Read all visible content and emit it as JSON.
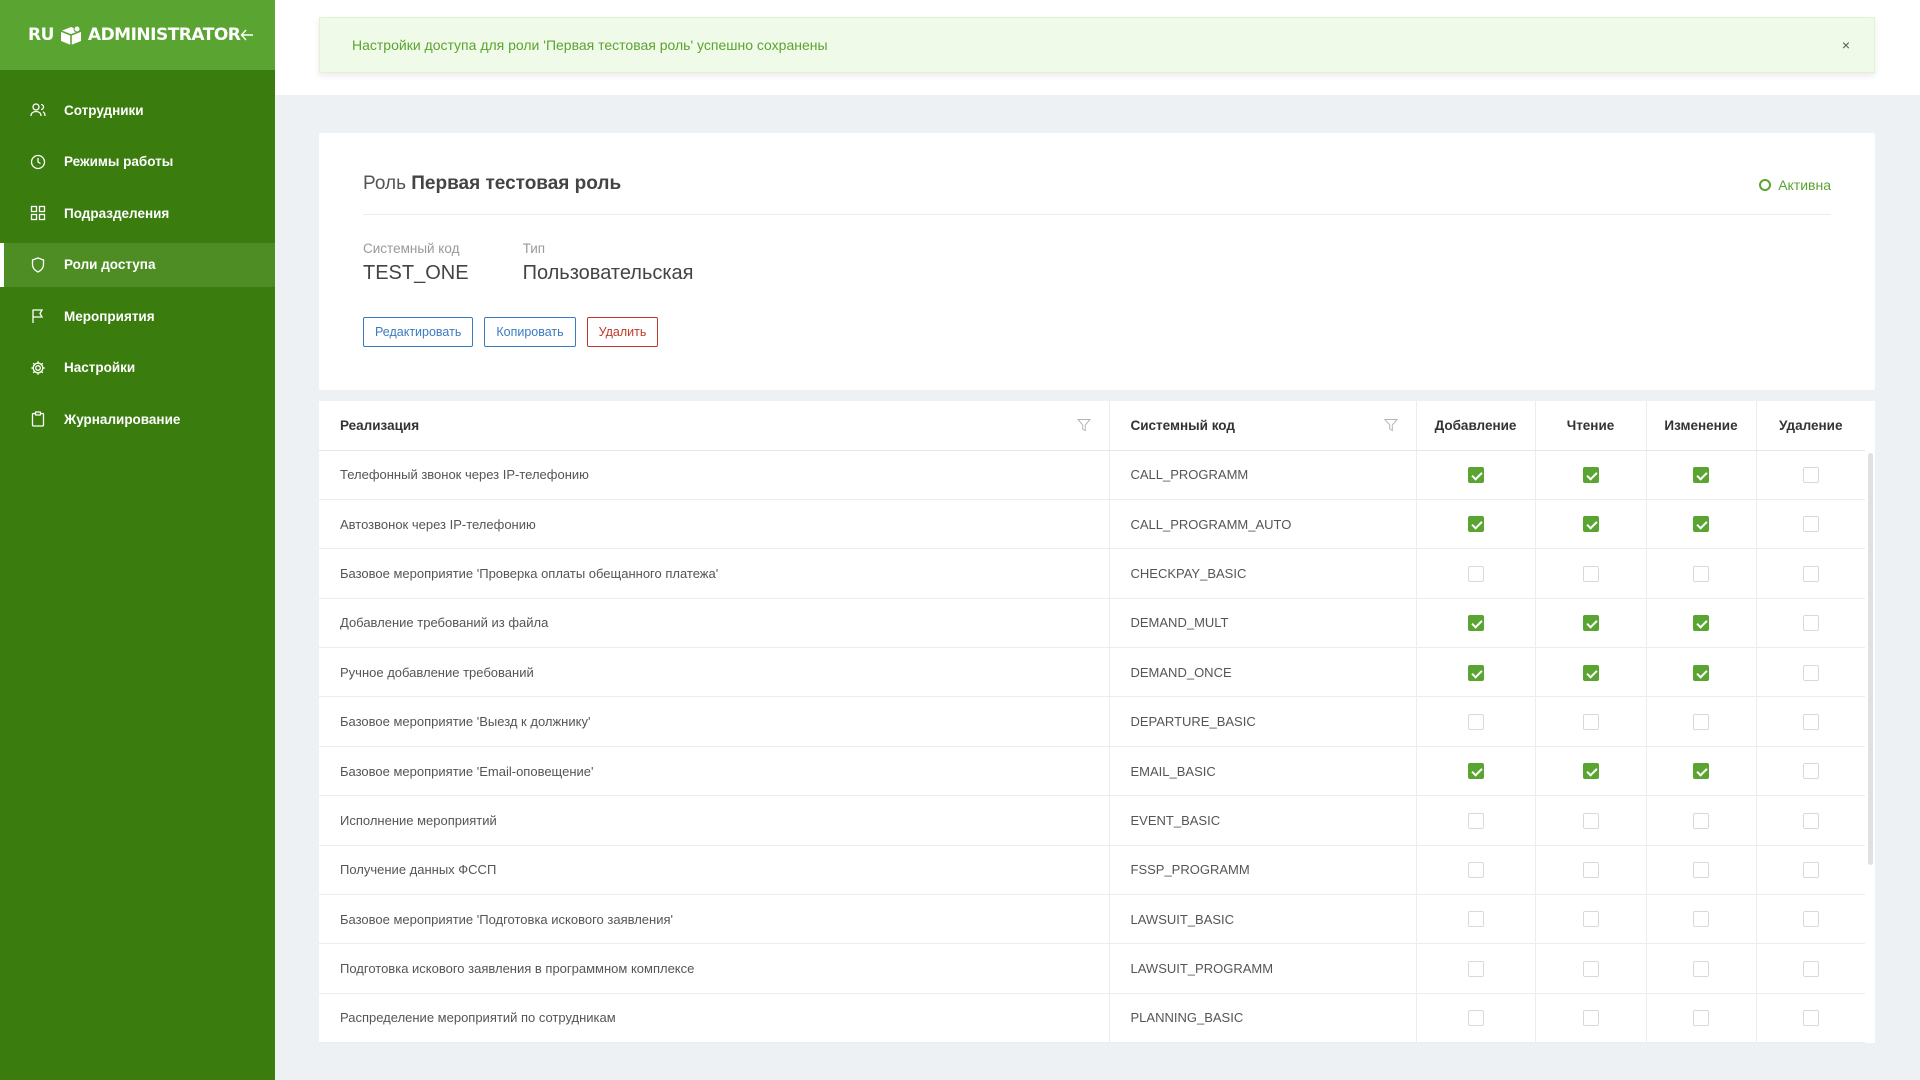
{
  "sidebar": {
    "logo_left": "RU",
    "logo_right": "ADMINISTRATOR",
    "items": [
      {
        "label": "Сотрудники",
        "icon": "users-icon"
      },
      {
        "label": "Режимы работы",
        "icon": "clock-icon"
      },
      {
        "label": "Подразделения",
        "icon": "grid-icon"
      },
      {
        "label": "Роли доступа",
        "icon": "shield-icon"
      },
      {
        "label": "Мероприятия",
        "icon": "flag-icon"
      },
      {
        "label": "Настройки",
        "icon": "gear-icon"
      },
      {
        "label": "Журналирование",
        "icon": "clipboard-icon"
      }
    ],
    "active_index": 3
  },
  "alert": {
    "message": "Настройки доступа для роли 'Первая тестовая роль' успешно сохранены",
    "close": "×"
  },
  "role": {
    "prefix": "Роль",
    "name": "Первая тестовая роль",
    "status": "Активна",
    "code_label": "Системный код",
    "code": "TEST_ONE",
    "type_label": "Тип",
    "type": "Пользовательская",
    "edit_label": "Редактировать",
    "copy_label": "Копировать",
    "delete_label": "Удалить"
  },
  "table": {
    "headers": [
      "Реализация",
      "Системный код",
      "Добавление",
      "Чтение",
      "Изменение",
      "Удаление"
    ],
    "rows": [
      {
        "name": "Телефонный звонок через IP-телефонию",
        "code": "CALL_PROGRAMM",
        "perms": [
          true,
          true,
          true,
          false
        ]
      },
      {
        "name": "Автозвонок через IP-телефонию",
        "code": "CALL_PROGRAMM_AUTO",
        "perms": [
          true,
          true,
          true,
          false
        ]
      },
      {
        "name": "Базовое мероприятие 'Проверка оплаты обещанного платежа'",
        "code": "CHECKPAY_BASIC",
        "perms": [
          false,
          false,
          false,
          false
        ]
      },
      {
        "name": "Добавление требований из файла",
        "code": "DEMAND_MULT",
        "perms": [
          true,
          true,
          true,
          false
        ]
      },
      {
        "name": "Ручное добавление требований",
        "code": "DEMAND_ONCE",
        "perms": [
          true,
          true,
          true,
          false
        ]
      },
      {
        "name": "Базовое мероприятие 'Выезд к должнику'",
        "code": "DEPARTURE_BASIC",
        "perms": [
          false,
          false,
          false,
          false
        ]
      },
      {
        "name": "Базовое мероприятие 'Email-оповещение'",
        "code": "EMAIL_BASIC",
        "perms": [
          true,
          true,
          true,
          false
        ]
      },
      {
        "name": "Исполнение мероприятий",
        "code": "EVENT_BASIC",
        "perms": [
          false,
          false,
          false,
          false
        ]
      },
      {
        "name": "Получение данных ФССП",
        "code": "FSSP_PROGRAMM",
        "perms": [
          false,
          false,
          false,
          false
        ]
      },
      {
        "name": "Базовое мероприятие 'Подготовка искового заявления'",
        "code": "LAWSUIT_BASIC",
        "perms": [
          false,
          false,
          false,
          false
        ]
      },
      {
        "name": "Подготовка искового заявления в программном комплексе",
        "code": "LAWSUIT_PROGRAMM",
        "perms": [
          false,
          false,
          false,
          false
        ]
      },
      {
        "name": "Распределение мероприятий по сотрудникам",
        "code": "PLANNING_BASIC",
        "perms": [
          false,
          false,
          false,
          false
        ]
      }
    ]
  },
  "colors": {
    "sidebar": "#3a7d0e",
    "accent": "#5aa431",
    "link": "#3c7ac0",
    "danger": "#c0392b"
  }
}
